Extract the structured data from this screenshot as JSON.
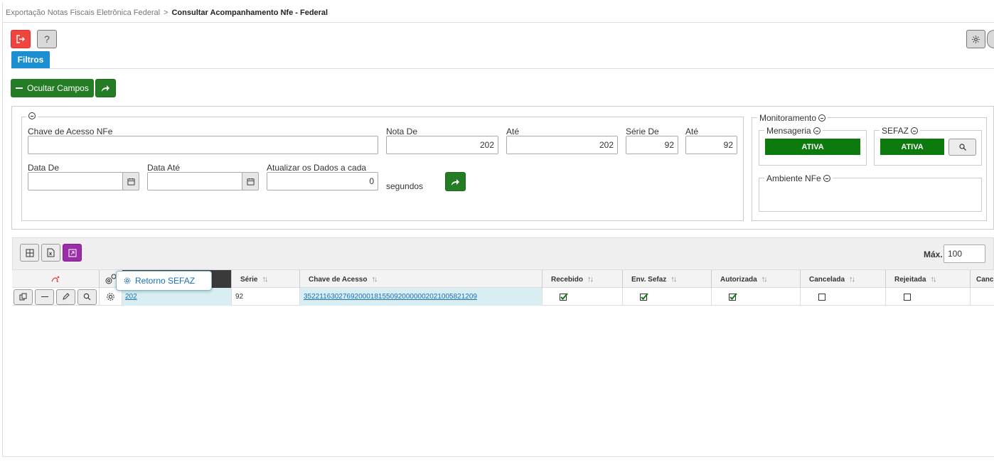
{
  "breadcrumb": {
    "parent": "Exportação Notas Fiscais Eletrônica Federal",
    "separator": ">",
    "current": "Consultar Acompanhamento Nfe - Federal"
  },
  "toolbar": {
    "exit_icon": "exit-icon",
    "help_label": "?",
    "settings_icon": "gear-icon"
  },
  "tabs": {
    "filtros": "Filtros"
  },
  "actions": {
    "ocultar_campos": "Ocultar Campos"
  },
  "filters": {
    "chave_label": "Chave de Acesso NFe",
    "chave_value": "",
    "nota_de_label": "Nota De",
    "nota_de_value": "202",
    "nota_ate_label": "Até",
    "nota_ate_value": "202",
    "serie_de_label": "Série De",
    "serie_de_value": "92",
    "serie_ate_label": "Até",
    "serie_ate_value": "92",
    "data_de_label": "Data De",
    "data_de_value": "",
    "data_ate_label": "Data Até",
    "data_ate_value": "",
    "atualizar_label": "Atualizar os Dados a cada",
    "atualizar_value": "0",
    "segundos_label": "segundos"
  },
  "monitoramento": {
    "title": "Monitoramento",
    "mensageria_label": "Mensageria",
    "mensageria_status": "ATIVA",
    "sefaz_label": "SEFAZ",
    "sefaz_status": "ATIVA",
    "ambiente_label": "Ambiente NFe",
    "status_color": "#0d7a0d"
  },
  "grid": {
    "max_label": "Máx.",
    "max_value": "100",
    "columns": {
      "serie": "Série",
      "chave": "Chave de Acesso",
      "recebido": "Recebido",
      "env_sefaz": "Env. Sefaz",
      "autorizada": "Autorizada",
      "cancelada": "Cancelada",
      "rejeitada": "Rejeitada",
      "canc_truncated": "Canc"
    },
    "rows": [
      {
        "nota": "202",
        "serie": "92",
        "chave": "35221163027692000181550920000002021005821209",
        "recebido": true,
        "env_sefaz": true,
        "autorizada": true,
        "cancelada": false,
        "rejeitada": false
      }
    ],
    "tooltip": "Retorno SEFAZ"
  },
  "colors": {
    "primary_blue": "#1c8fd1",
    "green": "#247c25",
    "red": "#f0443f",
    "purple": "#9b2ea8",
    "row_highlight": "#d8eef3"
  }
}
